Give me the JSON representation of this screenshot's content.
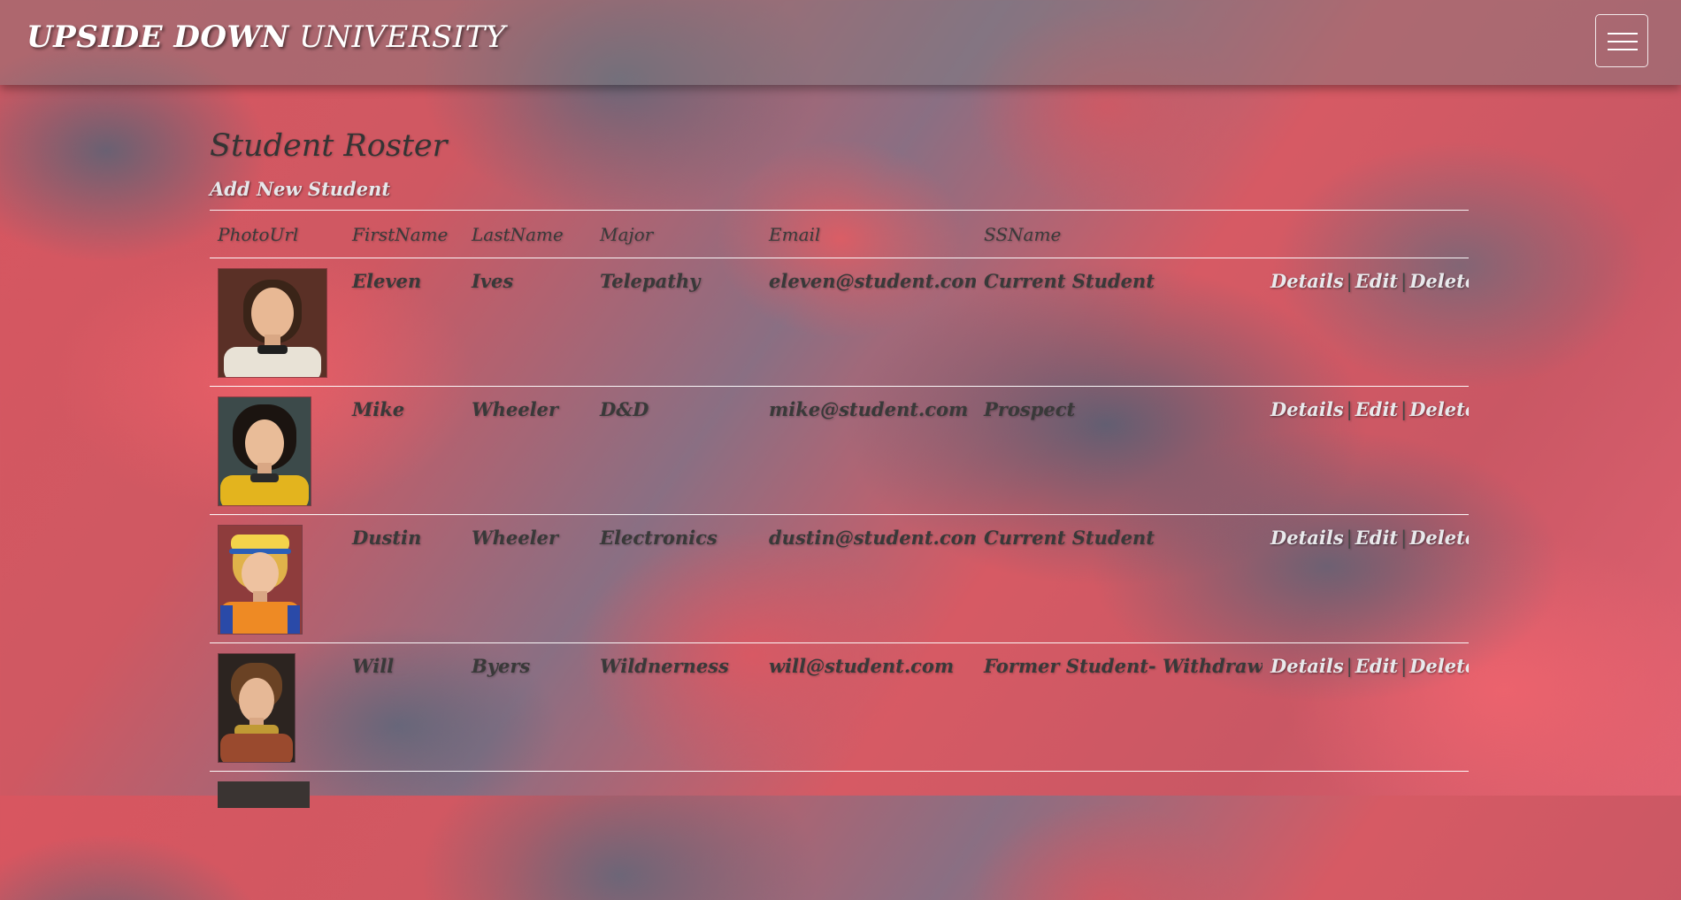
{
  "brand": {
    "part1": "UPSIDE DOWN",
    "part2": "UNIVERSITY"
  },
  "navbar": {
    "menu_icon": "hamburger-menu-icon"
  },
  "page": {
    "title": "Student Roster",
    "add_link": "Add New Student"
  },
  "table": {
    "headers": [
      "PhotoUrl",
      "FirstName",
      "LastName",
      "Major",
      "Email",
      "SSName"
    ],
    "actions": {
      "details": "Details",
      "edit": "Edit",
      "delete": "Delete",
      "separator": "|"
    },
    "rows": [
      {
        "first": "Eleven",
        "last": "Ives",
        "major": "Telepathy",
        "email": "eleven@student.com",
        "status": "Current Student",
        "photo": {
          "shirt": "#e8e2d6",
          "hair": "#3a2418",
          "bg": "#5a3026",
          "collar": "#1f1f1f"
        }
      },
      {
        "first": "Mike",
        "last": "Wheeler",
        "major": "D&D",
        "email": "mike@student.com",
        "status": "Prospect",
        "photo": {
          "shirt": "#e3b41e",
          "hair": "#1b1410",
          "bg": "#3c4a4a",
          "collar": "#2a2a2a"
        }
      },
      {
        "first": "Dustin",
        "last": "Wheeler",
        "major": "Electronics",
        "email": "dustin@student.com",
        "status": "Current Student",
        "photo": {
          "shirt": "#ee8a24",
          "hair": "#e0b24a",
          "bg": "#8e3c3c",
          "collar": "#2a4aa8"
        }
      },
      {
        "first": "Will",
        "last": "Byers",
        "major": "Wildnerness",
        "email": "will@student.com",
        "status": "Former Student- Withdrawn",
        "photo": {
          "shirt": "#9a4a2e",
          "hair": "#6a4224",
          "bg": "#2c2420",
          "collar": "#c09a34"
        }
      }
    ]
  }
}
